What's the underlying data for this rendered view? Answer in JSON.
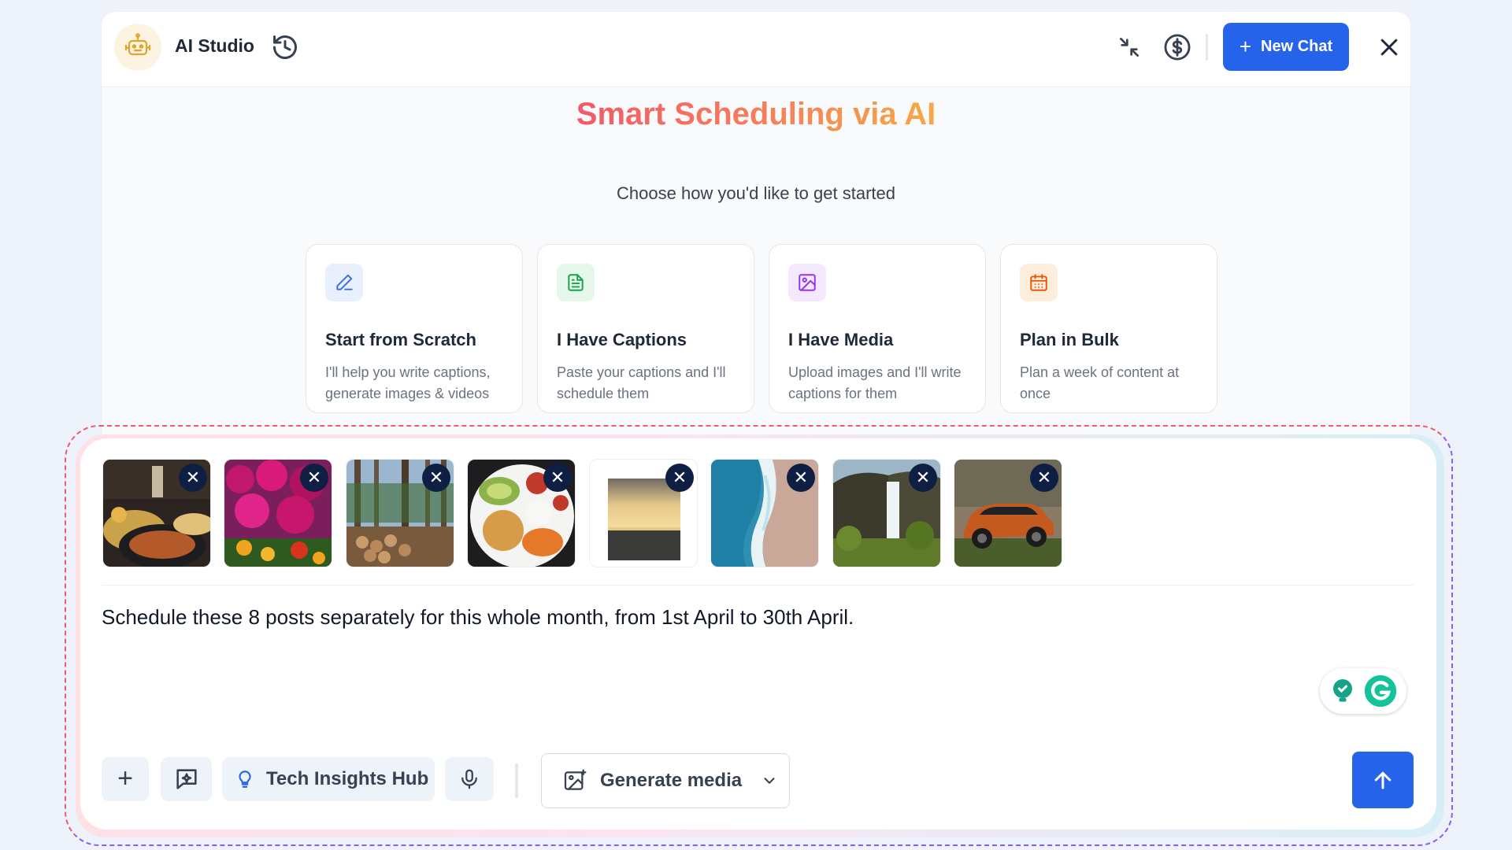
{
  "header": {
    "app_title": "AI Studio",
    "new_chat_label": "New Chat",
    "new_chat_plus": "+",
    "icons": [
      "robot-icon",
      "history-icon",
      "collapse-icon",
      "dollar-icon",
      "close-icon"
    ]
  },
  "hero": {
    "title": "Smart Scheduling via AI",
    "subtitle": "Choose how you'd like to get started"
  },
  "cards": [
    {
      "title": "Start from Scratch",
      "desc": "I'll help you write captions, generate images & videos",
      "icon": "pencil-icon",
      "accent": "#3b6fe0",
      "bg": "#e8f0fe"
    },
    {
      "title": "I Have Captions",
      "desc": "Paste your captions and I'll schedule them",
      "icon": "document-icon",
      "accent": "#16a34a",
      "bg": "#e6f7ec"
    },
    {
      "title": "I Have Media",
      "desc": "Upload images and I'll write captions for them",
      "icon": "image-icon",
      "accent": "#9333ea",
      "bg": "#f3e8fd"
    },
    {
      "title": "Plan in Bulk",
      "desc": "Plan a week of content at once",
      "icon": "calendar-icon",
      "accent": "#ea580c",
      "bg": "#fdeedc"
    }
  ],
  "composer": {
    "attachments": [
      {
        "name": "food-platter-thumbnail",
        "remove": "✕"
      },
      {
        "name": "pink-flowers-thumbnail",
        "remove": "✕"
      },
      {
        "name": "forest-logs-thumbnail",
        "remove": "✕"
      },
      {
        "name": "salad-bowl-thumbnail",
        "remove": "✕"
      },
      {
        "name": "sunset-sea-thumbnail",
        "remove": "✕"
      },
      {
        "name": "beach-waves-thumbnail",
        "remove": "✕"
      },
      {
        "name": "waterfall-cliff-thumbnail",
        "remove": "✕"
      },
      {
        "name": "orange-suv-thumbnail",
        "remove": "✕"
      }
    ],
    "prompt_text": "Schedule these 8 posts separately for this whole month, from 1st April to 30th April.",
    "toolbar": {
      "add_plus": "+",
      "brand_label": "Tech Insights Hub",
      "generate_media_label": "Generate media"
    }
  },
  "colors": {
    "primary": "#2563eb",
    "remove_badge": "#0f1f44",
    "title_gradient": [
      "#f25a6a",
      "#f7a845"
    ]
  }
}
